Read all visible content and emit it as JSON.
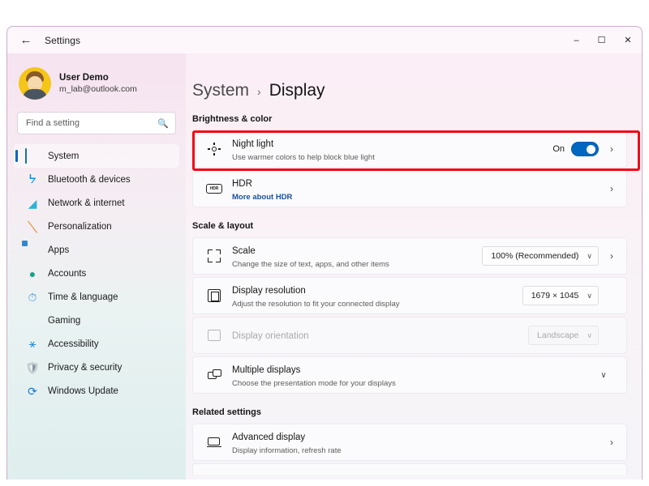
{
  "window": {
    "title": "Settings",
    "back_icon": "back-arrow-icon",
    "minimize": "–",
    "maximize": "☐",
    "close": "✕"
  },
  "account": {
    "name": "User Demo",
    "email": "m_lab@outlook.com"
  },
  "search": {
    "placeholder": "Find a setting",
    "icon": "search-icon"
  },
  "sidebar": {
    "items": [
      {
        "label": "System",
        "icon": "monitor-icon",
        "active": true
      },
      {
        "label": "Bluetooth & devices",
        "icon": "bluetooth-icon",
        "active": false
      },
      {
        "label": "Network & internet",
        "icon": "wifi-icon",
        "active": false
      },
      {
        "label": "Personalization",
        "icon": "paintbrush-icon",
        "active": false
      },
      {
        "label": "Apps",
        "icon": "apps-icon",
        "active": false
      },
      {
        "label": "Accounts",
        "icon": "person-icon",
        "active": false
      },
      {
        "label": "Time & language",
        "icon": "clock-icon",
        "active": false
      },
      {
        "label": "Gaming",
        "icon": "gamepad-icon",
        "active": false
      },
      {
        "label": "Accessibility",
        "icon": "accessibility-icon",
        "active": false
      },
      {
        "label": "Privacy & security",
        "icon": "shield-icon",
        "active": false
      },
      {
        "label": "Windows Update",
        "icon": "update-icon",
        "active": false
      }
    ]
  },
  "breadcrumb": {
    "parent": "System",
    "separator": "›",
    "current": "Display"
  },
  "sections": {
    "brightness": {
      "heading": "Brightness & color",
      "night_light": {
        "title": "Night light",
        "subtitle": "Use warmer colors to help block blue light",
        "toggle_label": "On",
        "toggle_state": "on",
        "icon": "sun-icon",
        "chevron": "›",
        "highlighted": true
      },
      "hdr": {
        "title": "HDR",
        "subtitle": "More about HDR",
        "subtitle_is_link": true,
        "icon": "hdr-badge-icon",
        "chevron": "›"
      }
    },
    "scale_layout": {
      "heading": "Scale & layout",
      "scale": {
        "title": "Scale",
        "subtitle": "Change the size of text, apps, and other items",
        "value": "100% (Recommended)",
        "icon": "scale-icon",
        "chevron": "›",
        "dropdown_chevron": "∨"
      },
      "resolution": {
        "title": "Display resolution",
        "subtitle": "Adjust the resolution to fit your connected display",
        "value": "1679 × 1045",
        "icon": "resolution-icon",
        "dropdown_chevron": "∨"
      },
      "orientation": {
        "title": "Display orientation",
        "subtitle": "",
        "value": "Landscape",
        "icon": "orientation-icon",
        "disabled": true,
        "dropdown_chevron": "∨"
      },
      "multiple_displays": {
        "title": "Multiple displays",
        "subtitle": "Choose the presentation mode for your displays",
        "icon": "multiple-displays-icon",
        "chevron": "∨"
      }
    },
    "related": {
      "heading": "Related settings",
      "advanced_display": {
        "title": "Advanced display",
        "subtitle": "Display information, refresh rate",
        "icon": "advanced-display-icon",
        "chevron": "›"
      }
    }
  },
  "colors": {
    "accent": "#0067c0",
    "highlight_border": "#ee0a17",
    "link": "#1a4f9c"
  }
}
